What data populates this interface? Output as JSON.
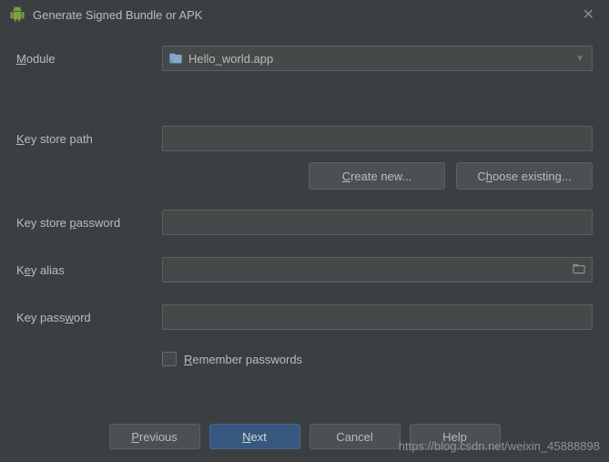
{
  "titlebar": {
    "title": "Generate Signed Bundle or APK"
  },
  "module": {
    "label": "Module",
    "value": "Hello_world.app"
  },
  "keystorePath": {
    "label": "Key store path",
    "value": ""
  },
  "buttons": {
    "createNew": "Create new...",
    "chooseExisting": "Choose existing..."
  },
  "keystorePassword": {
    "label": "Key store password",
    "value": ""
  },
  "keyAlias": {
    "label": "Key alias",
    "value": ""
  },
  "keyPassword": {
    "label": "Key password",
    "value": ""
  },
  "remember": {
    "label": "Remember passwords"
  },
  "footer": {
    "previous": "Previous",
    "next": "Next",
    "cancel": "Cancel",
    "help": "Help"
  },
  "watermark": "https://blog.csdn.net/weixin_45888898"
}
